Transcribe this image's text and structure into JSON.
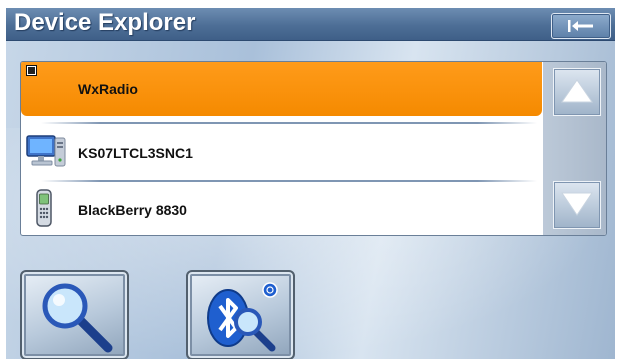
{
  "window": {
    "title": "Device Explorer"
  },
  "toolbar": {
    "back_icon": "back-arrow-icon"
  },
  "device_list": {
    "items": [
      {
        "label": "WxRadio",
        "icon": "radio-checkbox-icon",
        "selected": true,
        "checked": true
      },
      {
        "label": "KS07LTCL3SNC1",
        "icon": "computer-icon",
        "selected": false
      },
      {
        "label": "BlackBerry 8830",
        "icon": "mobile-phone-icon",
        "selected": false
      }
    ]
  },
  "scroll": {
    "up_icon": "scroll-up-arrow-icon",
    "down_icon": "scroll-down-arrow-icon"
  },
  "actions": {
    "search_icon": "magnifier-icon",
    "bluetooth_search_icon": "bluetooth-search-icon"
  },
  "colors": {
    "selection": "#f58a00",
    "titlebar": "#4d6e96",
    "background": "#b8cbe0"
  }
}
